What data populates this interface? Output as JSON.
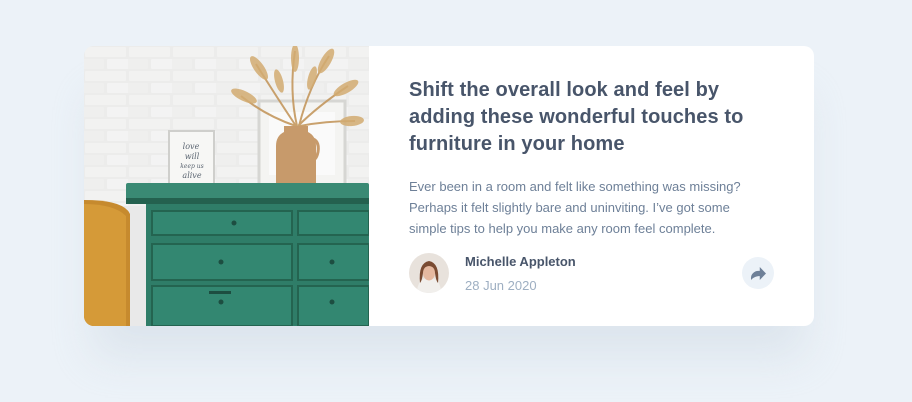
{
  "card": {
    "headline": "Shift the overall look and feel by adding these wonderful touches to furniture in your home",
    "excerpt": "Ever been in a room and felt like something was missing? Perhaps it felt slightly bare and uninviting. I’ve got some simple tips to help you make any room feel complete.",
    "photo": {
      "frame_text_line1": "love",
      "frame_text_line2": "will",
      "frame_text_line3": "keep us",
      "frame_text_line4": "alive"
    },
    "author": {
      "name": "Michelle Appleton",
      "date": "28 Jun 2020"
    },
    "share_icon": "share-icon"
  },
  "colors": {
    "page_background": "#ecf2f8",
    "heading": "#48556a",
    "body_text": "#6e8098",
    "muted_text": "#9eafc2",
    "dresser_green": "#2f7d68",
    "share_button_bg": "#ecf2f8",
    "share_icon": "#6e8098"
  }
}
